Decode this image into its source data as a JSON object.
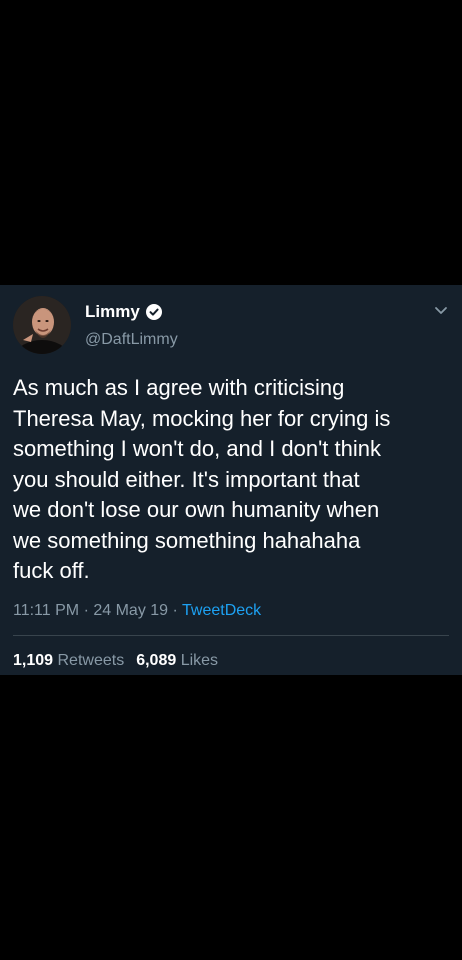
{
  "tweet": {
    "display_name": "Limmy",
    "handle": "@DaftLimmy",
    "text": "As much as I agree with criticising\nTheresa May, mocking her for crying is\nsomething I won't do, and I don't think\nyou should either. It's important that\nwe don't lose our own humanity when\nwe something something hahahaha\nfuck off.",
    "time": "11:11 PM",
    "separator": "·",
    "date": "24 May 19",
    "source": "TweetDeck",
    "retweets_count": "1,109",
    "retweets_label": "Retweets",
    "likes_count": "6,089",
    "likes_label": "Likes"
  },
  "icons": {
    "verified": "verified-badge-icon",
    "caret": "chevron-down-icon"
  },
  "colors": {
    "card_background": "#15202b",
    "page_background": "#000000",
    "text_primary": "#ffffff",
    "text_secondary": "#8899a6",
    "link": "#1da1f2",
    "divider": "#38444d"
  }
}
